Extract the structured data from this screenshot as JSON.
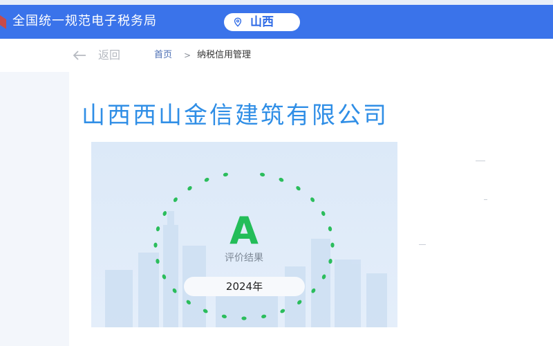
{
  "header": {
    "site_title": "全国统一规范电子税务局",
    "region": "山西",
    "icons": {
      "region": "location-pin-icon",
      "logo": "emblem-logo"
    },
    "colors": {
      "bar": "#3a73ea",
      "region_text": "#2e6ae6"
    }
  },
  "nav": {
    "back_label": "返回",
    "back_icon": "arrow-left-icon",
    "breadcrumb": {
      "home": "首页",
      "separator": ">",
      "current": "纳税信用管理"
    }
  },
  "company": {
    "name": "山西西山金信建筑有限公司",
    "color": "#2f8ee6"
  },
  "rating": {
    "grade": "A",
    "caption": "评价结果",
    "year": "2024年",
    "colors": {
      "grade": "#23bd59",
      "gauge_dots": "#2bbd5c"
    }
  }
}
